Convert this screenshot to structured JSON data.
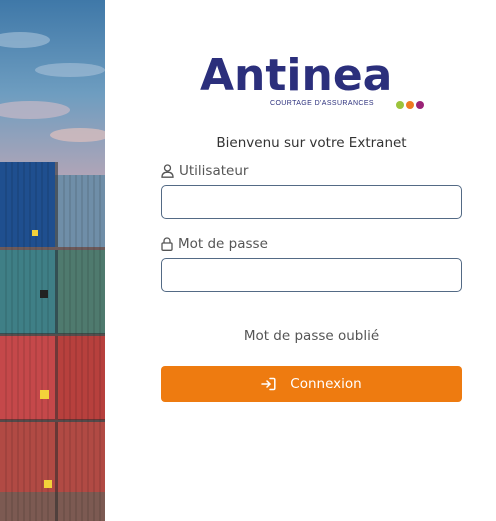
{
  "brand": {
    "name": "Antinea",
    "tagline": "COURTAGE D'ASSURANCES",
    "dot_colors": [
      "#9cc33b",
      "#ef7a21",
      "#9b2277"
    ],
    "text_color": "#2b2f7c"
  },
  "login": {
    "welcome": "Bienvenu sur votre Extranet",
    "username_label": "Utilisateur",
    "username_icon": "user-icon",
    "username_value": "",
    "password_label": "Mot de passe",
    "password_icon": "lock-icon",
    "password_value": "",
    "forgot_link": "Mot de passe oublié",
    "submit_label": "Connexion",
    "submit_icon": "sign-in-icon",
    "accent_color": "#ee7b10"
  }
}
